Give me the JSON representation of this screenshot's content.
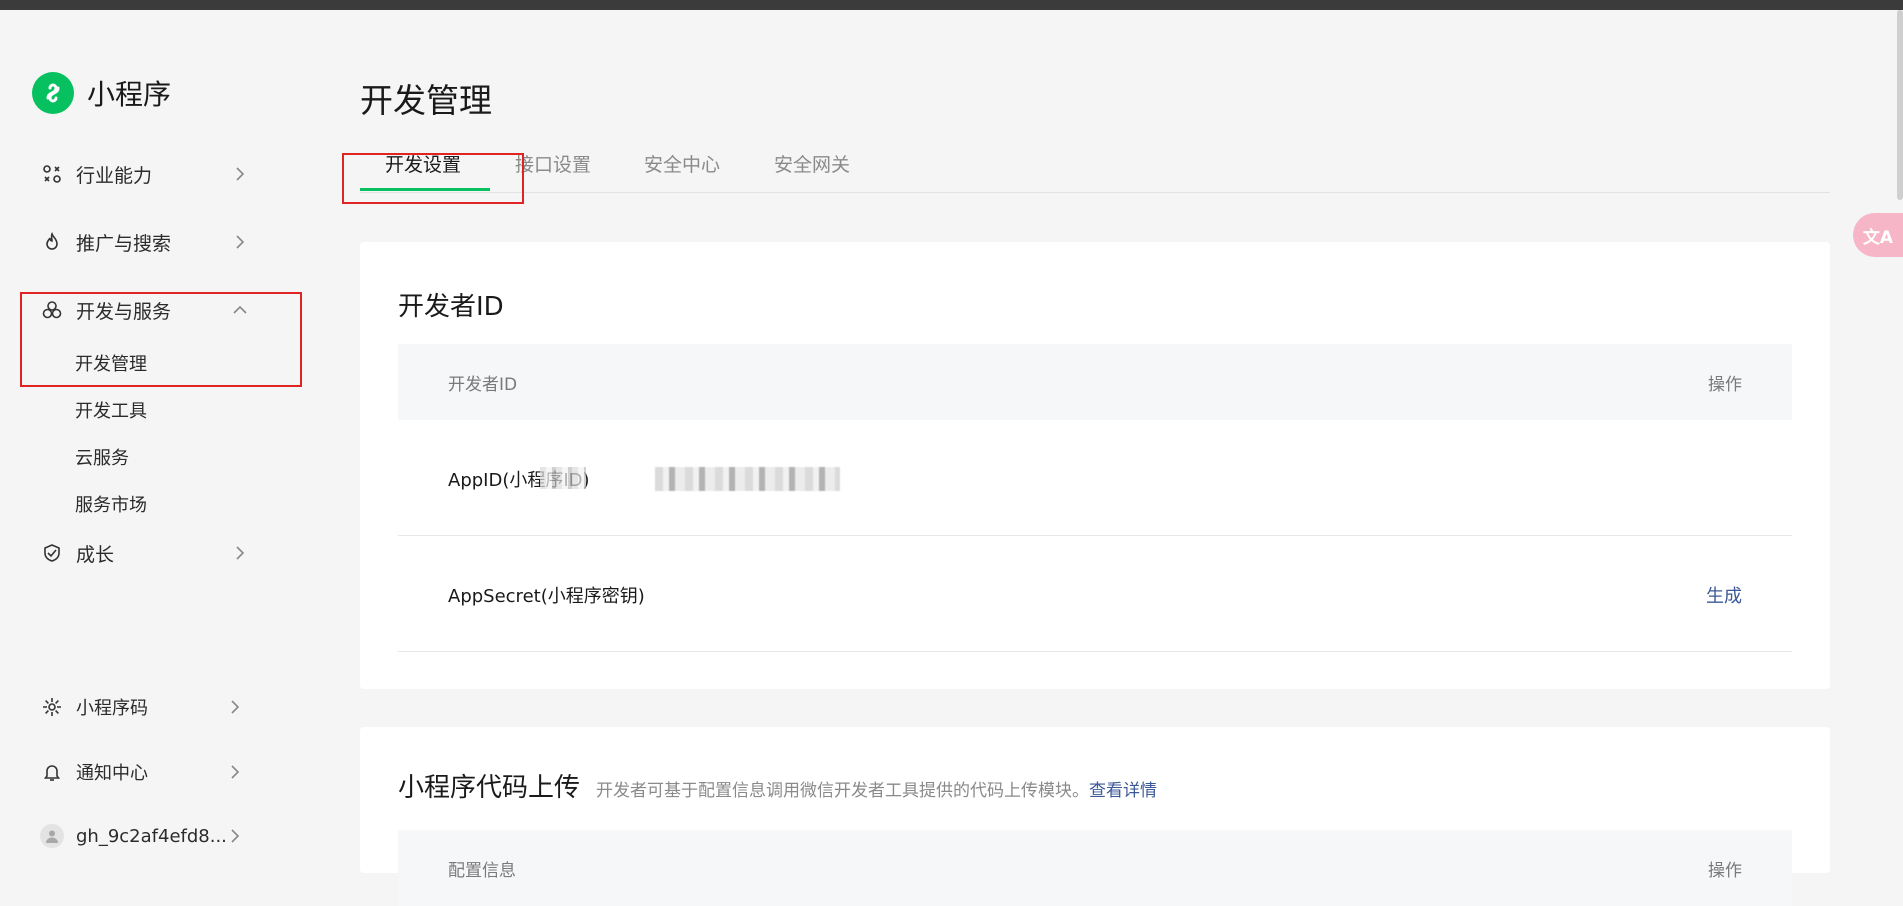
{
  "app": {
    "name": "小程序"
  },
  "sidebar": {
    "items": [
      {
        "label": "行业能力"
      },
      {
        "label": "推广与搜索"
      },
      {
        "label": "开发与服务"
      },
      {
        "label": "成长"
      }
    ],
    "dev_sub_items": [
      {
        "label": "开发管理"
      },
      {
        "label": "开发工具"
      },
      {
        "label": "云服务"
      },
      {
        "label": "服务市场"
      }
    ],
    "bottom_items": [
      {
        "label": "小程序码"
      },
      {
        "label": "通知中心"
      },
      {
        "label": "gh_9c2af4efd8..."
      }
    ]
  },
  "main": {
    "title": "开发管理",
    "tabs": [
      {
        "label": "开发设置"
      },
      {
        "label": "接口设置"
      },
      {
        "label": "安全中心"
      },
      {
        "label": "安全网关"
      }
    ]
  },
  "developer_id_card": {
    "title": "开发者ID",
    "header_col1": "开发者ID",
    "header_col2": "操作",
    "rows": [
      {
        "label": "AppID(小程序ID)",
        "action": ""
      },
      {
        "label": "AppSecret(小程序密钥)",
        "action": "生成"
      }
    ]
  },
  "upload_card": {
    "title": "小程序代码上传",
    "description": "开发者可基于配置信息调用微信开发者工具提供的代码上传模块。",
    "link": "查看详情",
    "header_col1": "配置信息",
    "header_col2": "操作"
  },
  "translate_button": {
    "label": "文A"
  },
  "colors": {
    "brand_green": "#07c160",
    "link": "#3b5998",
    "highlight": "#e02424"
  }
}
